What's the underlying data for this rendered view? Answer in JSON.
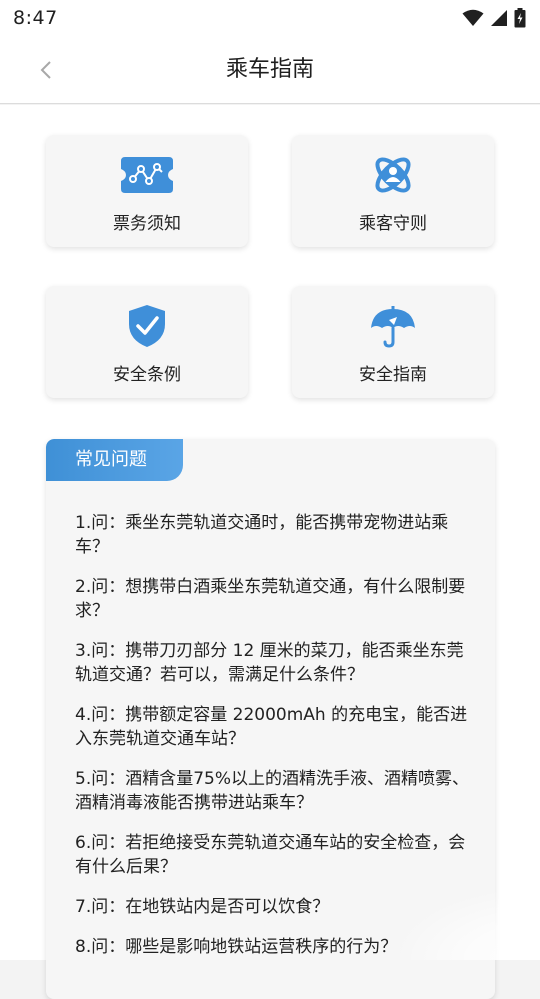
{
  "status_bar": {
    "time": "8:47",
    "icons": [
      "wifi-icon",
      "signal-icon",
      "battery-charging-icon"
    ]
  },
  "app_bar": {
    "title": "乘车指南",
    "back_icon": "chevron-left-icon"
  },
  "cards": [
    {
      "label": "票务须知",
      "icon": "ticket-icon",
      "color": "#3f8fd9"
    },
    {
      "label": "乘客守则",
      "icon": "passenger-atom-icon",
      "color": "#3f8fd9"
    },
    {
      "label": "安全条例",
      "icon": "shield-check-icon",
      "color": "#3f8fd9"
    },
    {
      "label": "安全指南",
      "icon": "umbrella-icon",
      "color": "#3f8fd9"
    }
  ],
  "faq": {
    "title": "常见问题",
    "items": [
      "1.问：乘坐东莞轨道交通时，能否携带宠物进站乘车？",
      "2.问：想携带白酒乘坐东莞轨道交通，有什么限制要求？",
      "3.问：携带刀刃部分 12 厘米的菜刀，能否乘坐东莞轨道交通？若可以，需满足什么条件？",
      "4.问：携带额定容量 22000mAh 的充电宝，能否进入东莞轨道交通车站？",
      "5.问：酒精含量75%以上的酒精洗手液、酒精喷雾、酒精消毒液能否携带进站乘车？",
      "6.问：若拒绝接受东莞轨道交通车站的安全检查，会有什么后果？",
      "7.问：在地铁站内是否可以饮食？",
      "8.问：哪些是影响地铁站运营秩序的行为？"
    ]
  },
  "colors": {
    "accent": "#3f8fd9",
    "header_gradient_start": "#3f90d6",
    "header_gradient_end": "#5aa5e6"
  }
}
